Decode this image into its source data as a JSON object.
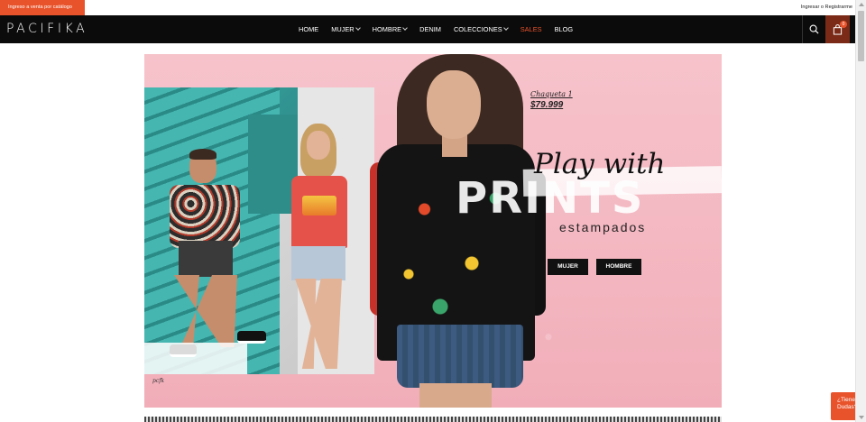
{
  "topbar": {
    "catalog_link": "Ingreso a venta por catálogo",
    "login_link": "Ingresar o Registrarme"
  },
  "nav": {
    "logo": "PACIFIKA",
    "items": [
      {
        "label": "HOME",
        "has_dropdown": false
      },
      {
        "label": "MUJER",
        "has_dropdown": true
      },
      {
        "label": "HOMBRE",
        "has_dropdown": true
      },
      {
        "label": "DENIM",
        "has_dropdown": false
      },
      {
        "label": "COLECCIONES",
        "has_dropdown": true
      },
      {
        "label": "SALES",
        "has_dropdown": false,
        "highlight": true
      },
      {
        "label": "BLOG",
        "has_dropdown": false
      }
    ],
    "cart_count": "0",
    "search_icon": "search-icon",
    "cart_icon": "shopping-bag-icon"
  },
  "hero": {
    "price_label": "Chaqueta 1",
    "price_value": "$79.999",
    "headline_script": "Play with",
    "headline_bold": "PRINTS",
    "subheadline": "estampados",
    "cta_women": "MUJER",
    "cta_men": "HOMBRE",
    "photo_signature": "pcfk"
  },
  "help": {
    "label_line1": "¿Tienes",
    "label_line2": "Dudas?"
  },
  "colors": {
    "accent": "#e8532b",
    "navbar": "#0b0b0b",
    "hero_bg": "#f4b9c2",
    "cart_bg": "#7a2a16"
  }
}
